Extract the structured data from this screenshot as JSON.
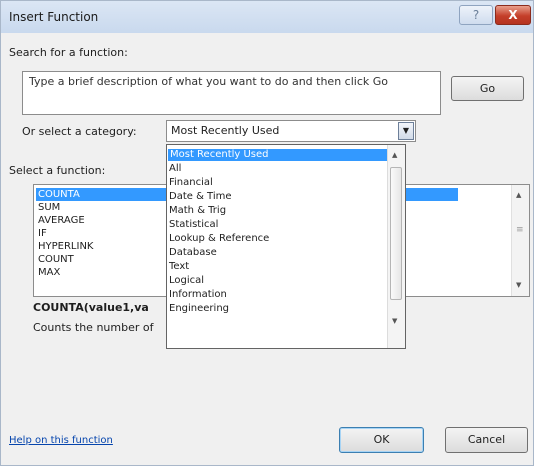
{
  "window": {
    "title": "Insert Function",
    "help_glyph": "?",
    "close_glyph": "X"
  },
  "search": {
    "label": "Search for a function:",
    "value": "Type a brief description of what you want to do and then click Go",
    "go_label": "Go"
  },
  "category": {
    "label": "Or select a category:",
    "selected": "Most Recently Used",
    "arrow_glyph": "▼",
    "options": [
      "Most Recently Used",
      "All",
      "Financial",
      "Date & Time",
      "Math & Trig",
      "Statistical",
      "Lookup & Reference",
      "Database",
      "Text",
      "Logical",
      "Information",
      "Engineering"
    ]
  },
  "function_list": {
    "label": "Select a function:",
    "items": [
      "COUNTA",
      "SUM",
      "AVERAGE",
      "IF",
      "HYPERLINK",
      "COUNT",
      "MAX"
    ],
    "selected": "COUNTA"
  },
  "description": {
    "signature": "COUNTA(value1,va",
    "text": "Counts the number of"
  },
  "footer": {
    "help_link": "Help on this function",
    "ok_label": "OK",
    "cancel_label": "Cancel"
  },
  "colors": {
    "selection": "#3399ff",
    "close_button": "#c43f2a",
    "link": "#0645ad"
  },
  "icons": {
    "scroll_up": "▲",
    "scroll_down": "▼",
    "scroll_grip": "≡"
  }
}
